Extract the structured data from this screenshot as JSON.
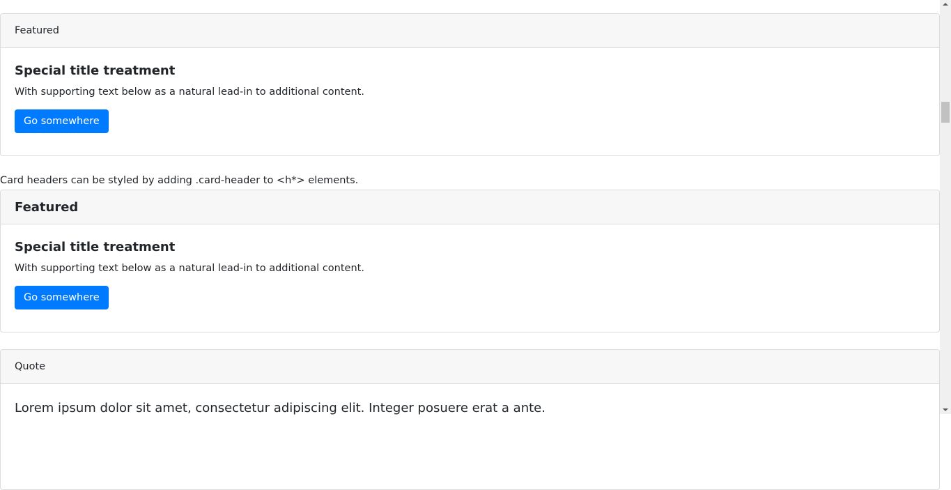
{
  "cards": [
    {
      "header": "Featured",
      "title": "Special title treatment",
      "text": "With supporting text below as a natural lead-in to additional content.",
      "button": "Go somewhere"
    },
    {
      "header": "Featured",
      "title": "Special title treatment",
      "text": "With supporting text below as a natural lead-in to additional content.",
      "button": "Go somewhere"
    },
    {
      "header": "Quote",
      "text": "Lorem ipsum dolor sit amet, consectetur adipiscing elit. Integer posuere erat a ante."
    }
  ],
  "note": "Card headers can be styled by adding .card-header to <h*> elements.",
  "colors": {
    "primary": "#007bff",
    "header_bg": "#f7f7f7",
    "border": "#dcdcdc"
  }
}
